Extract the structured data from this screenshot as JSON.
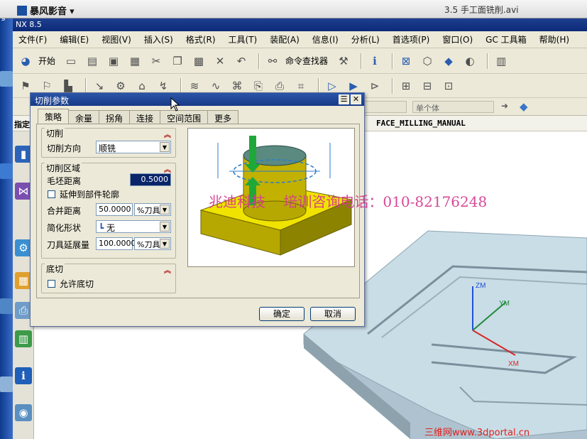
{
  "player": {
    "app_name": "暴风影音",
    "file_title": "3.5 手工面铣削.avi",
    "left_edge_char": "g"
  },
  "nx": {
    "title": "NX 8.5"
  },
  "menubar": {
    "items": [
      "文件(F)",
      "编辑(E)",
      "视图(V)",
      "插入(S)",
      "格式(R)",
      "工具(T)",
      "装配(A)",
      "信息(I)",
      "分析(L)",
      "首选项(P)",
      "窗口(O)",
      "GC 工具箱",
      "帮助(H)"
    ]
  },
  "toolbar": {
    "start_label": "开始",
    "command_finder": "命令查找器"
  },
  "filterbar": {
    "single_body": "单个体"
  },
  "navbar": {
    "label": "指定",
    "operation": "FACE_MILLING_MANUAL"
  },
  "dialog": {
    "title": "切削参数",
    "tabs": [
      "策略",
      "余量",
      "拐角",
      "连接",
      "空间范围",
      "更多"
    ],
    "active_tab": "策略",
    "cutting": {
      "title": "切削",
      "direction_label": "切削方向",
      "direction_value": "顺铣"
    },
    "cut_region": {
      "title": "切削区域",
      "blank_distance_label": "毛坯距离",
      "blank_distance_value": "0.5000",
      "extend_label": "延伸到部件轮廓",
      "merge_distance_label": "合并距离",
      "merge_distance_value": "50.0000",
      "merge_unit": "%刀具",
      "simplify_label": "简化形状",
      "simplify_value": "无",
      "tool_extend_label": "刀具延展量",
      "tool_extend_value": "100.0000",
      "tool_extend_unit": "%刀具"
    },
    "undercut": {
      "title": "底切",
      "allow_label": "允许底切"
    },
    "ok": "确定",
    "cancel": "取消"
  },
  "watermark": {
    "company": "兆迪科技",
    "phone": "培训咨询电话：010-82176248",
    "site": "三维网www.3dportal.cn"
  },
  "axes": {
    "z": "ZM",
    "y": "YM",
    "x": "XM"
  },
  "colors": {
    "title_bar": "#173a86",
    "part": "#c9dde6",
    "preview_yellow": "#d6c400",
    "watermark": "#d43a8f"
  }
}
